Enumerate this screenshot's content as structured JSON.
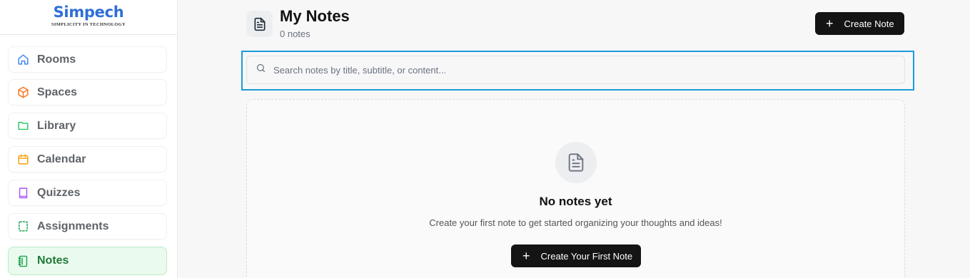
{
  "brand": {
    "name": "Simpech",
    "tagline": "SIMPLICITY IN TECHNOLOGY",
    "color": "#2f6fd6"
  },
  "sidebar": {
    "items": [
      {
        "label": "Rooms",
        "icon": "home-icon",
        "color": "#3b82f6",
        "active": false
      },
      {
        "label": "Spaces",
        "icon": "cube-icon",
        "color": "#f97316",
        "active": false
      },
      {
        "label": "Library",
        "icon": "folder-icon",
        "color": "#22c55e",
        "active": false
      },
      {
        "label": "Calendar",
        "icon": "calendar-icon",
        "color": "#f59e0b",
        "active": false
      },
      {
        "label": "Quizzes",
        "icon": "book-icon",
        "color": "#a855f7",
        "active": false
      },
      {
        "label": "Assignments",
        "icon": "dashed-square-icon",
        "color": "#16a34a",
        "active": false
      },
      {
        "label": "Notes",
        "icon": "notebook-icon",
        "color": "#16a34a",
        "active": true
      }
    ]
  },
  "header": {
    "title": "My Notes",
    "count": "0 notes",
    "create_label": "Create Note"
  },
  "search": {
    "placeholder": "Search notes by title, subtitle, or content...",
    "value": ""
  },
  "empty_state": {
    "title": "No notes yet",
    "subtitle": "Create your first note to get started organizing your thoughts and ideas!",
    "button_label": "Create Your First Note"
  }
}
